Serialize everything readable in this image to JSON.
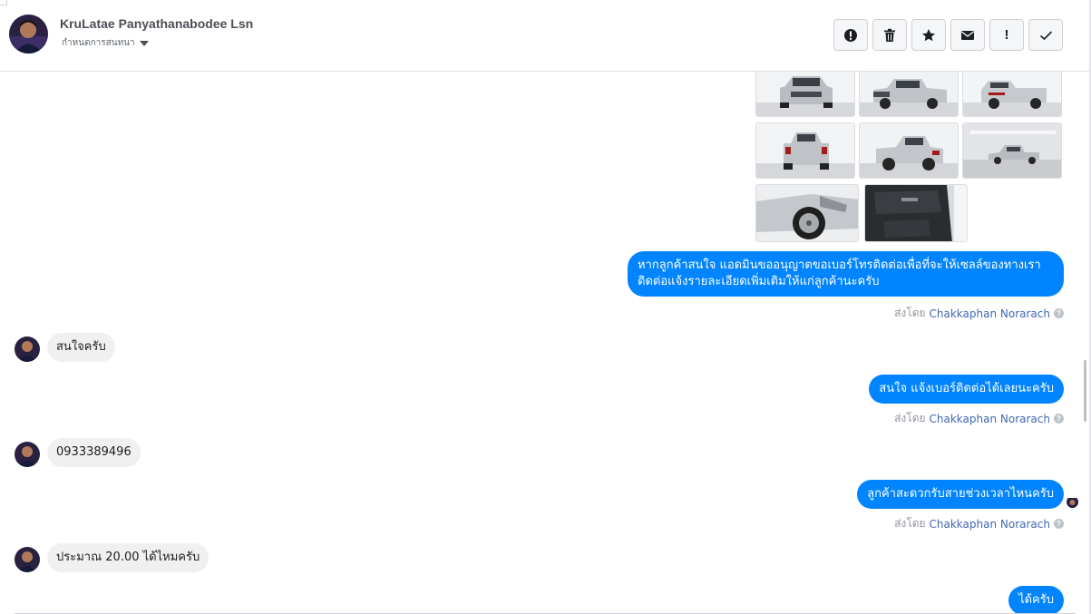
{
  "header": {
    "name": "KruLatae Panyathanabodee Lsn",
    "subtitle": "กำหนดการสนทนา"
  },
  "toolbar": {
    "buttons": [
      {
        "name": "alert-circle-icon",
        "label": ""
      },
      {
        "name": "trash-icon",
        "label": ""
      },
      {
        "name": "star-icon",
        "label": ""
      },
      {
        "name": "envelope-icon",
        "label": ""
      },
      {
        "name": "exclamation-icon",
        "label": "!"
      },
      {
        "name": "checkmark-icon",
        "label": ""
      }
    ]
  },
  "colors": {
    "accent": "#0084ff",
    "incoming_bubble": "#f1f0f0",
    "agent_link": "#4267b2",
    "border": "#ccd0d5"
  },
  "photos": [
    {
      "name": "pickup-front-photo"
    },
    {
      "name": "pickup-front-angle-photo"
    },
    {
      "name": "pickup-rear-angle-photo"
    },
    {
      "name": "pickup-rear-photo"
    },
    {
      "name": "pickup-rear-three-quarter-photo"
    },
    {
      "name": "pickup-side-photo"
    },
    {
      "name": "pickup-wheel-closeup-photo"
    },
    {
      "name": "pickup-door-interior-photo"
    }
  ],
  "messages": [
    {
      "direction": "outgoing",
      "text": "หากลูกค้าสนใจ แอดมินขออนุญาตขอเบอร์โทรติดต่อเพื่อที่จะให้เซลล์ของทางเราติดต่อแจ้งรายละเอียดเพิ่มเติมให้แก่ลูกค้านะครับ",
      "sent_by_prefix": "ส่งโดย",
      "sent_by_name": "Chakkaphan Norarach"
    },
    {
      "direction": "incoming",
      "text": "สนใจครับ"
    },
    {
      "direction": "outgoing",
      "text": "สนใจ แจ้งเบอร์ติดต่อได้เลยนะครับ",
      "sent_by_prefix": "ส่งโดย",
      "sent_by_name": "Chakkaphan Norarach"
    },
    {
      "direction": "incoming",
      "text": "0933389496"
    },
    {
      "direction": "outgoing",
      "text": "ลูกค้าสะดวกรับสายช่วงเวลาไหนครับ",
      "sent_by_prefix": "ส่งโดย",
      "sent_by_name": "Chakkaphan Norarach"
    },
    {
      "direction": "incoming",
      "text": "ประมาณ 20.00 ได้ไหมครับ"
    },
    {
      "direction": "outgoing",
      "text": "ได้ครับ"
    }
  ]
}
